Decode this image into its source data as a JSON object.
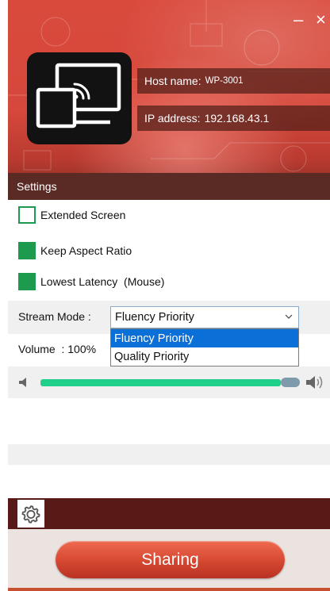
{
  "window": {
    "minimize_glyph": "–",
    "close_glyph": "×"
  },
  "device": {
    "logo_icon": "screen-mirroring-icon",
    "host_label": "Host name:",
    "host_value": "WP-3001",
    "ip_label": "IP address:",
    "ip_value": "192.168.43.1"
  },
  "settings": {
    "title": "Settings"
  },
  "options": [
    {
      "label": "Extended Screen",
      "checked": false
    },
    {
      "label": "Keep Aspect Ratio",
      "checked": true
    },
    {
      "label": "Lowest Latency  (Mouse)",
      "checked": true
    }
  ],
  "stream_mode": {
    "label": "Stream Mode :",
    "selected": "Fluency Priority",
    "options": [
      "Fluency Priority",
      "Quality Priority"
    ]
  },
  "volume": {
    "label": "Volume  : 100%",
    "value_percent": 100
  },
  "footer": {
    "share_label": "Sharing",
    "settings_icon": "gear-icon"
  },
  "colors": {
    "accent_red": "#d94a3c",
    "check_green": "#1e9a4e",
    "slider_green": "#20d08a",
    "dropdown_highlight": "#0a6fd6"
  }
}
